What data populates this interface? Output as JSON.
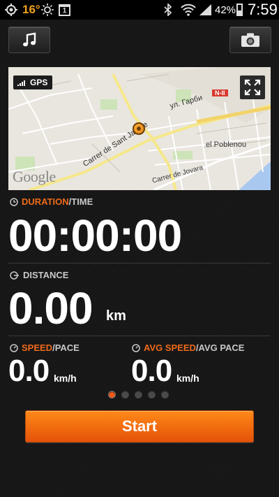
{
  "status_bar": {
    "temperature": "16°",
    "notification_count": "1",
    "battery": "42%",
    "time": "7:59"
  },
  "map": {
    "gps_label": "GPS",
    "labels": {
      "street_jaume": "Carrer de Sant Jaume",
      "street_garbi": "ул. Гарби",
      "road_badge": "N-II",
      "district": "el Poblenou",
      "street_jovara": "Carrer de Jovara"
    },
    "provider": "Google"
  },
  "duration": {
    "label_primary": "DURATION",
    "label_secondary": "/TIME",
    "value": "00:00:00"
  },
  "distance": {
    "label": "DISTANCE",
    "value": "0.00",
    "unit": "km"
  },
  "speed": {
    "label_primary": "SPEED",
    "label_secondary": "/PACE",
    "value": "0.0",
    "unit": "km/h"
  },
  "avg_speed": {
    "label_primary": "AVG SPEED",
    "label_secondary": "/AVG PACE",
    "value": "0.0",
    "unit": "km/h"
  },
  "pager": {
    "pages": 5,
    "active_index": 0
  },
  "start_button_label": "Start",
  "colors": {
    "accent": "#ee6a1a",
    "start_button": "#f26d0f"
  }
}
